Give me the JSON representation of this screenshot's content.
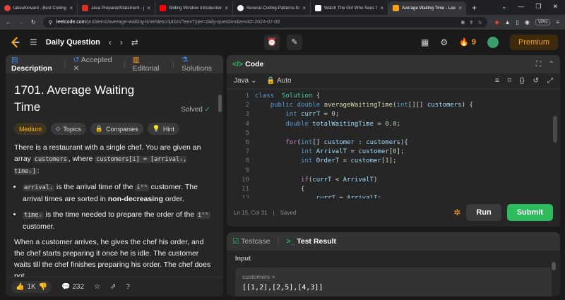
{
  "browser": {
    "tabs": [
      {
        "title": "takeuforward - Best Coding Tut",
        "color": "#e94235",
        "active": false
      },
      {
        "title": "Java PreparedStatement - javat",
        "color": "#d93025",
        "active": false
      },
      {
        "title": "Sliding Window Introduction Id",
        "color": "#ff0000",
        "active": false
      },
      {
        "title": "Several-Coding-Patterns-for-Sc",
        "color": "#f0f0f0",
        "active": false
      },
      {
        "title": "Watch The Girl Who Sees Smell",
        "color": "#ffffff",
        "active": false
      },
      {
        "title": "Average Waiting Time - Lee",
        "color": "#ffa116",
        "active": true
      }
    ],
    "url_host": "leetcode.com",
    "url_path": "/problems/average-waiting-time/description/?envType=daily-question&envId=2024-07-09",
    "vpn_label": "VPN"
  },
  "nav": {
    "title": "Daily Question",
    "streak": "9",
    "premium": "Premium"
  },
  "left": {
    "tabs": {
      "description": "Description",
      "accepted": "Accepted",
      "editorial": "Editorial",
      "solutions": "Solutions"
    },
    "problem_title": "1701. Average Waiting Time",
    "status": "Solved",
    "chips": {
      "difficulty": "Medium",
      "topics": "Topics",
      "companies": "Companies",
      "hint": "Hint"
    },
    "p1_a": "There is a restaurant with a single chef. You are given an array ",
    "p1_code1": "customers",
    "p1_b": ", where ",
    "p1_code2": "customers[i] = [arrivalᵢ, timeᵢ]",
    "p1_c": ":",
    "b1_code": "arrivalᵢ",
    "b1_a": " is the arrival time of the ",
    "b1_sup": "iᵗʰ",
    "b1_b": " customer. The arrival times are sorted in ",
    "b1_bold": "non-decreasing",
    "b1_c": " order.",
    "b2_code": "timeᵢ",
    "b2_a": " is the time needed to prepare the order of the ",
    "b2_sup": "iᵗʰ",
    "b2_b": " customer.",
    "p2": "When a customer arrives, he gives the chef his order, and the chef starts preparing it once he is idle. The customer waits till the chef finishes preparing his order. The chef does not",
    "footer": {
      "likes": "1K",
      "comments": "232"
    }
  },
  "code": {
    "title": "Code",
    "language": "Java",
    "mode": "Auto",
    "line_numbers": [
      "1",
      "2",
      "3",
      "4",
      "5",
      "6",
      "7",
      "8",
      "9",
      "10",
      "11",
      "12"
    ],
    "status_pos": "Ln 15, Col 31",
    "status_saved": "Saved",
    "run": "Run",
    "submit": "Submit"
  },
  "test": {
    "tab_testcase": "Testcase",
    "tab_result": "Test Result",
    "input_label": "Input",
    "var_name": "customers =",
    "var_value": "[[1,2],[2,5],[4,3]]"
  }
}
